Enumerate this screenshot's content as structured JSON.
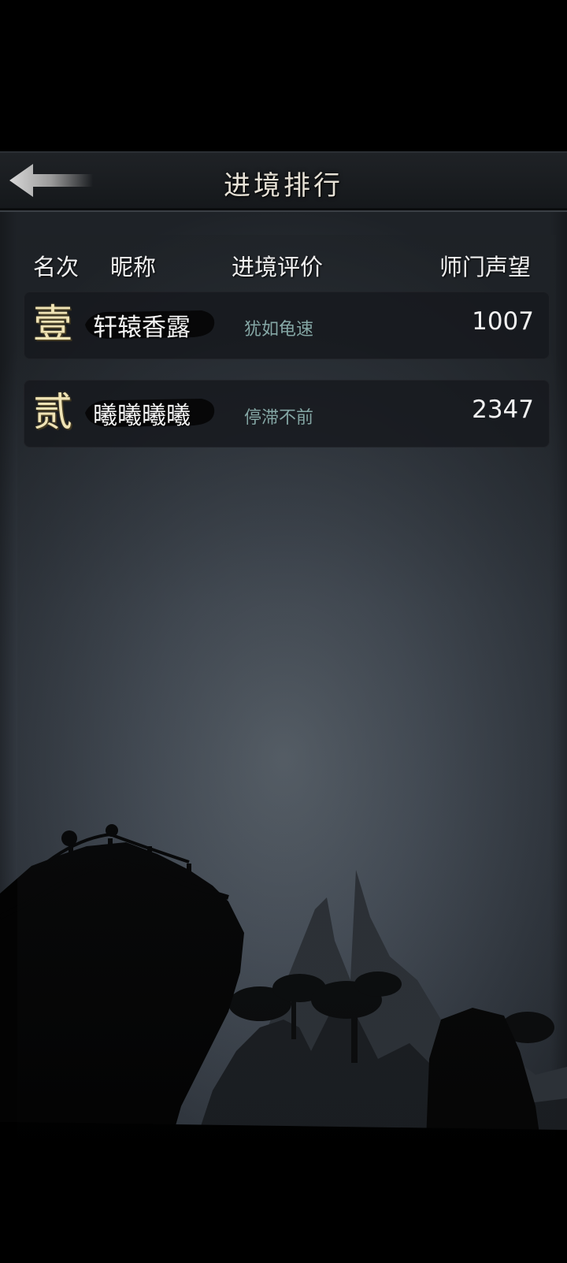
{
  "header": {
    "title": "进境排行",
    "back_icon": "back-arrow-icon"
  },
  "columns": {
    "rank": "名次",
    "nickname": "昵称",
    "evaluation": "进境评价",
    "reputation": "师门声望"
  },
  "rows": [
    {
      "rank": "壹",
      "nickname": "轩辕香露",
      "evaluation": "犹如龟速",
      "reputation": "1007"
    },
    {
      "rank": "贰",
      "nickname": "曦曦曦曦",
      "evaluation": "停滞不前",
      "reputation": "2347"
    }
  ],
  "colors": {
    "rank_numeral": "#efe3b5",
    "evaluation_text": "#84a6a4",
    "row_background": "#16191d"
  }
}
